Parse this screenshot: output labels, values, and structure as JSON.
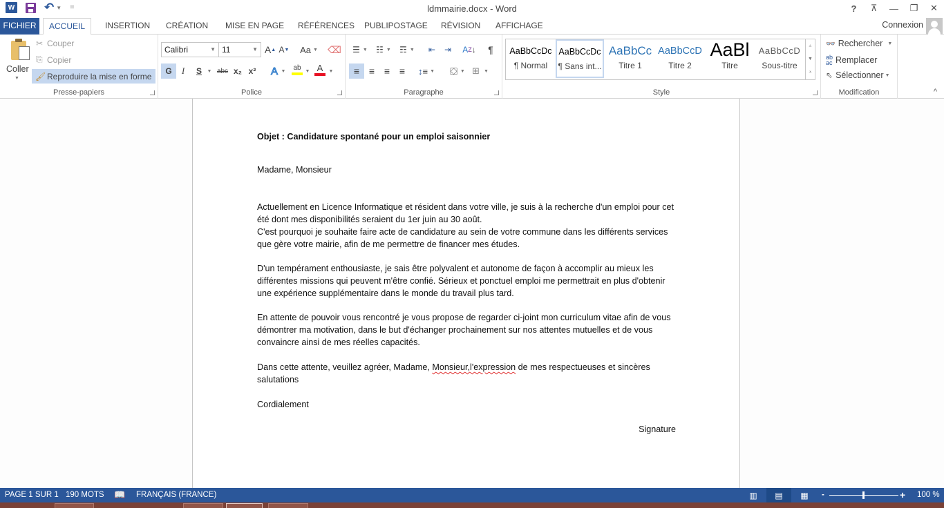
{
  "window": {
    "title": "ldmmairie.docx - Word",
    "controls": {
      "help": "?",
      "ribbon_display": "⊼",
      "minimize": "—",
      "restore": "❐",
      "close": "✕"
    }
  },
  "quick_access": {
    "app_icon": "W",
    "save_icon": "save-icon",
    "undo_icon": "↶",
    "customize": "="
  },
  "tabs": [
    {
      "label": "FICHIER"
    },
    {
      "label": "ACCUEIL",
      "active": true
    },
    {
      "label": "INSERTION"
    },
    {
      "label": "CRÉATION"
    },
    {
      "label": "MISE EN PAGE"
    },
    {
      "label": "RÉFÉRENCES"
    },
    {
      "label": "PUBLIPOSTAGE"
    },
    {
      "label": "RÉVISION"
    },
    {
      "label": "AFFICHAGE"
    }
  ],
  "account": {
    "label": "Connexion"
  },
  "ribbon": {
    "clipboard": {
      "label": "Presse-papiers",
      "paste": "Coller",
      "cut": "Couper",
      "copy": "Copier",
      "format_painter": "Reproduire la mise en forme"
    },
    "font": {
      "label": "Police",
      "font_name": "Calibri",
      "font_size": "11",
      "grow": "A",
      "shrink": "A",
      "change_case": "Aa",
      "bold": "G",
      "italic": "I",
      "underline": "S",
      "strike": "abc",
      "subscript": "x₂",
      "superscript": "x²",
      "text_effects": "A",
      "highlight": "ab",
      "font_color": "A",
      "highlight_color": "#ffff00",
      "font_color_value": "#e81123"
    },
    "paragraph": {
      "label": "Paragraphe",
      "pilcrow": "¶"
    },
    "styles": {
      "label": "Style",
      "items": [
        {
          "preview": "AaBbCcDc",
          "name": "¶ Normal",
          "color": "#000000"
        },
        {
          "preview": "AaBbCcDc",
          "name": "¶ Sans int...",
          "color": "#000000",
          "selected": true
        },
        {
          "preview": "AaBbCc",
          "name": "Titre 1",
          "color": "#2e74b5"
        },
        {
          "preview": "AaBbCcD",
          "name": "Titre 2",
          "color": "#2e74b5"
        },
        {
          "preview": "AaBl",
          "name": "Titre",
          "color": "#000000"
        },
        {
          "preview": "AaBbCcD",
          "name": "Sous-titre",
          "color": "#5a5a5a"
        }
      ]
    },
    "editing": {
      "label": "Modification",
      "find": "Rechercher",
      "replace": "Remplacer",
      "select": "Sélectionner"
    }
  },
  "document": {
    "subject": "Objet : Candidature spontané pour un emploi saisonnier",
    "greeting": "Madame, Monsieur",
    "p1_line1": "Actuellement en Licence Informatique et résident dans votre ville, je suis à la recherche d'un emploi pour cet été dont mes disponibilités seraient du 1er juin au 30 août.",
    "p1_line2": "C'est pourquoi je souhaite faire acte de candidature au sein de votre commune dans les différents services que gère votre mairie, afin de me permettre de financer mes études.",
    "p2": "D'un tempérament enthousiaste, je sais être polyvalent et autonome de façon à accomplir au mieux les différentes missions qui peuvent m'être confié. Sérieux et ponctuel emploi me permettrait en plus d'obtenir une expérience supplémentaire dans le monde du travail plus tard.",
    "p3": "En attente de pouvoir vous rencontré je vous propose de regarder ci-joint mon curriculum vitae afin de vous démontrer ma motivation, dans le but d'échanger prochainement sur nos attentes mutuelles et de vous convaincre ainsi de mes réelles capacités.",
    "p4_before": "Dans cette attente, veuillez agréer, Madame, ",
    "p4_misspelled": "Monsieur,l'expression",
    "p4_after": " de mes respectueuses et sincères salutations",
    "closing": "Cordialement",
    "signature": "Signature"
  },
  "status": {
    "page": "PAGE 1 SUR 1",
    "words": "190 MOTS",
    "language": "FRANÇAIS (FRANCE)",
    "zoom": "100 %",
    "zoom_minus": "-",
    "zoom_plus": "+",
    "zoom_percent": 100
  }
}
